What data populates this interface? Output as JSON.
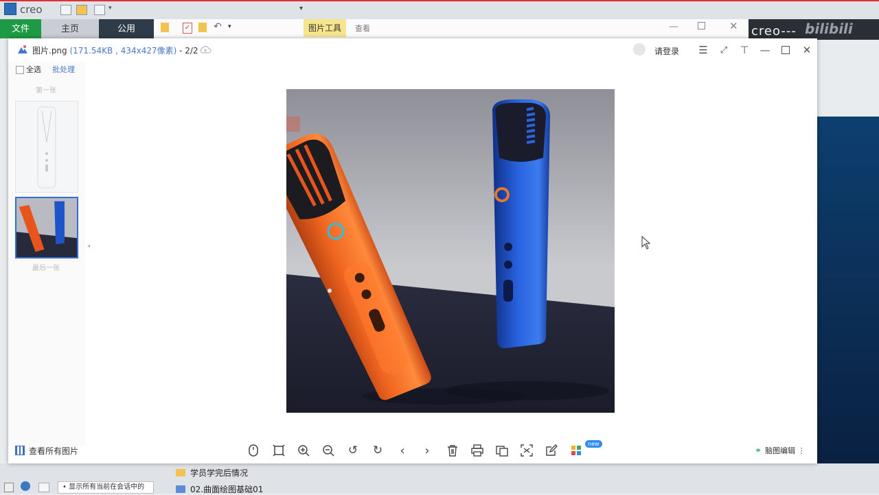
{
  "creo": {
    "logo": "creo",
    "tabs": {
      "file": "文件",
      "home": "主页",
      "share": "公用"
    },
    "ribbon_tools": "图片工具",
    "ribbon_view": "查看",
    "watermark": "creo---"
  },
  "explorer": {
    "files": [
      "学员学完后情况",
      "02.曲面绘图基础01"
    ],
    "status_note": "显示所有当前在会话中的"
  },
  "viewer": {
    "file_name": "图片.png",
    "file_meta": "(171.54KB , 434x427像素)",
    "index": "- 2/2",
    "login": "请登录",
    "sidebar": {
      "select_all": "全选",
      "batch": "批处理",
      "prev_label": "第一张",
      "next_label": "最后一张"
    },
    "toolbar": {
      "view_all": "查看所有图片",
      "new_badge": "new",
      "mind_map": "脑图编辑"
    }
  },
  "colors": {
    "accent_blue": "#2f6fd6",
    "creo_green": "#1f9a44",
    "ribbon_yellow": "#f6e58d"
  },
  "icons": [
    "mouse-icon",
    "fit-icon",
    "zoom-in-icon",
    "zoom-out-icon",
    "rotate-left-icon",
    "rotate-right-icon",
    "prev-icon",
    "next-icon",
    "delete-icon",
    "print-icon",
    "compare-icon",
    "scan-icon",
    "edit-icon",
    "grid-apps-icon",
    "mindmap-icon"
  ]
}
